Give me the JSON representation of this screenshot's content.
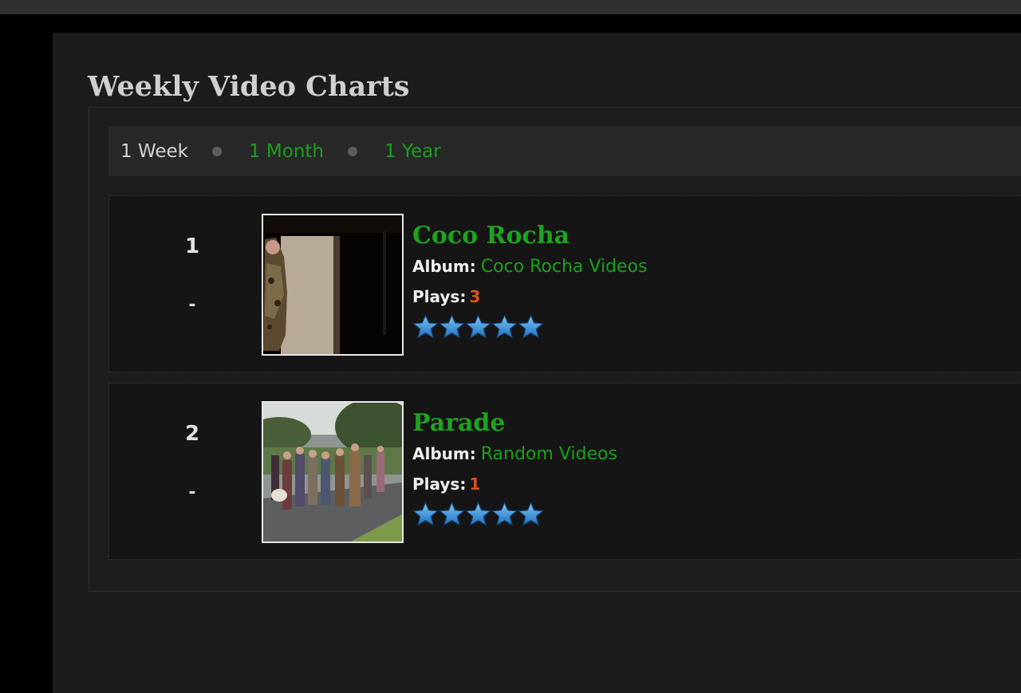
{
  "page": {
    "title": "Weekly Video Charts"
  },
  "tabs": [
    {
      "label": "1 Week",
      "active": true
    },
    {
      "label": "1 Month",
      "active": false
    },
    {
      "label": "1 Year",
      "active": false
    }
  ],
  "labels": {
    "album": "Album:",
    "plays": "Plays:"
  },
  "videos": [
    {
      "rank": "1",
      "change": "-",
      "title": "Coco Rocha",
      "album": "Coco Rocha Videos",
      "plays": "3",
      "rating": 5
    },
    {
      "rank": "2",
      "change": "-",
      "title": "Parade",
      "album": "Random Videos",
      "plays": "1",
      "rating": 5
    }
  ],
  "colors": {
    "link": "#19a11b",
    "plays": "#d9531c",
    "star": "#3a9de0"
  },
  "icons": {
    "separator": "bullet-separator-icon",
    "rating": "star-icon"
  }
}
